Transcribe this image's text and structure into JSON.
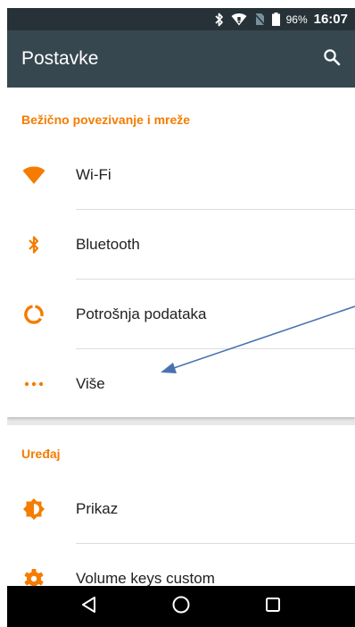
{
  "status_bar": {
    "battery_percent": "96%",
    "time": "16:07",
    "icons": [
      "bluetooth-icon",
      "wifi-icon",
      "no-sim-icon",
      "battery-icon"
    ]
  },
  "app_bar": {
    "title": "Postavke",
    "search_icon": "search-icon"
  },
  "sections": [
    {
      "header": "Bežično povezivanje i mreže",
      "items": [
        {
          "label": "Wi-Fi",
          "icon": "wifi-icon"
        },
        {
          "label": "Bluetooth",
          "icon": "bluetooth-icon"
        },
        {
          "label": "Potrošnja podataka",
          "icon": "data-usage-icon"
        },
        {
          "label": "Više",
          "icon": "more-dots-icon"
        }
      ]
    },
    {
      "header": "Uređaj",
      "items": [
        {
          "label": "Prikaz",
          "icon": "brightness-icon"
        },
        {
          "label": "Volume keys custom",
          "icon": "gear-icon"
        }
      ]
    }
  ],
  "nav_bar": {
    "buttons": [
      "back-icon",
      "home-icon",
      "recents-icon"
    ]
  },
  "colors": {
    "accent": "#f57c00",
    "app_bar": "#37474f",
    "status_bar": "#263238",
    "arrow": "#4a72b0"
  }
}
